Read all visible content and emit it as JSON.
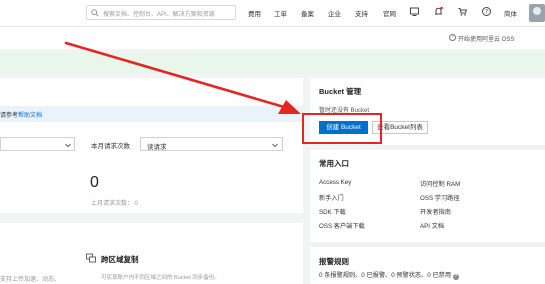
{
  "topbar": {
    "search_placeholder": "搜索文档、控制台、API、解决方案和资源",
    "nav": [
      "费用",
      "工单",
      "备案",
      "企业",
      "支持",
      "官网"
    ],
    "lang": "简体"
  },
  "subbar": {
    "oss_link": "开始使用阿里云 OSS"
  },
  "main": {
    "info_text": "请参考",
    "info_link": "帮助文档",
    "req_label": "本月请求次数",
    "req_select": "读请求",
    "big_number": "0",
    "last_req": "上月请求次数： 0"
  },
  "bottom": {
    "left_text": "支持上传加速、动态、",
    "cross_title": "跨区域复制",
    "cross_desc": "可实现账户内不同区域之间的 Bucket 同步备份。"
  },
  "bucket": {
    "title": "Bucket 管理",
    "empty": "暂时还没有 Bucket",
    "create": "创建 Bucket",
    "list": "查看Bucket列表"
  },
  "entries": {
    "title": "常用入口",
    "items": [
      "Access Key",
      "访问控制 RAM",
      "新手入门",
      "OSS 学习路径",
      "SDK 下载",
      "开发者指南",
      "OSS 客户端下载",
      "API 文档"
    ]
  },
  "alarm": {
    "title": "报警规则",
    "text": "0 条报警规则、0 已报警、0 预警状态、0 已禁用"
  },
  "colors": {
    "primary": "#0070cc",
    "annotation_red": "#e5261f",
    "info_bg": "#eaf3fc",
    "success_bg": "#e9f6ec"
  }
}
